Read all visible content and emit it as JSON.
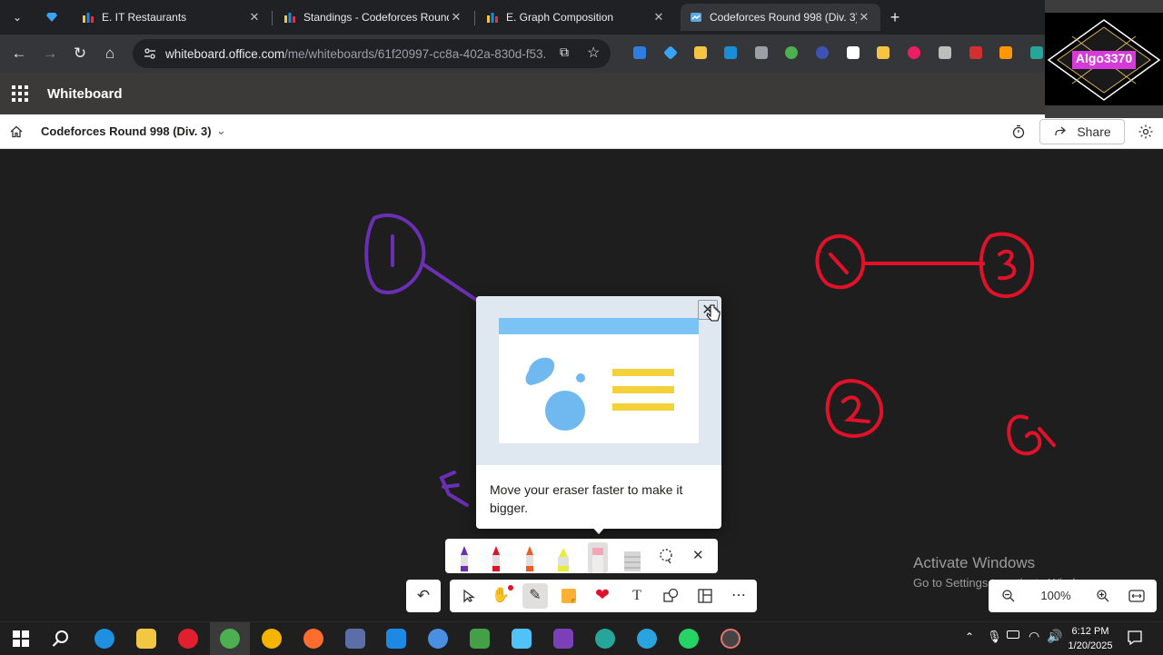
{
  "browser": {
    "tabs": [
      {
        "title": "",
        "active": false
      },
      {
        "title": "E. IT Restaurants",
        "active": false
      },
      {
        "title": "Standings - Codeforces Round",
        "active": false
      },
      {
        "title": "E. Graph Composition",
        "active": false
      },
      {
        "title": "Codeforces Round 998 (Div. 3)",
        "active": true
      }
    ],
    "new_tab_label": "+",
    "url_host": "whiteboard.office.com",
    "url_path": "/me/whiteboards/61f20997-cc8a-402a-830d-f53..."
  },
  "app": {
    "name": "Whiteboard",
    "board_title": "Codeforces Round 998 (Div. 3)",
    "share_label": "Share"
  },
  "overlay": {
    "channel_logo": "Algo3370"
  },
  "tip": {
    "text": "Move your eraser faster to make it bigger."
  },
  "zoom": {
    "value": "100%"
  },
  "watermark": {
    "line1": "Activate Windows",
    "line2": "Go to Settings to activate Windows."
  },
  "taskbar": {
    "time": "6:12 PM",
    "date": "1/20/2025"
  },
  "canvas_labels": [
    "1",
    "3",
    "1",
    "2",
    "5",
    "F"
  ],
  "colors": {
    "purple_ink": "#6b2fb3",
    "red_ink": "#e1112a",
    "toolbar_bg": "#ffffff"
  }
}
